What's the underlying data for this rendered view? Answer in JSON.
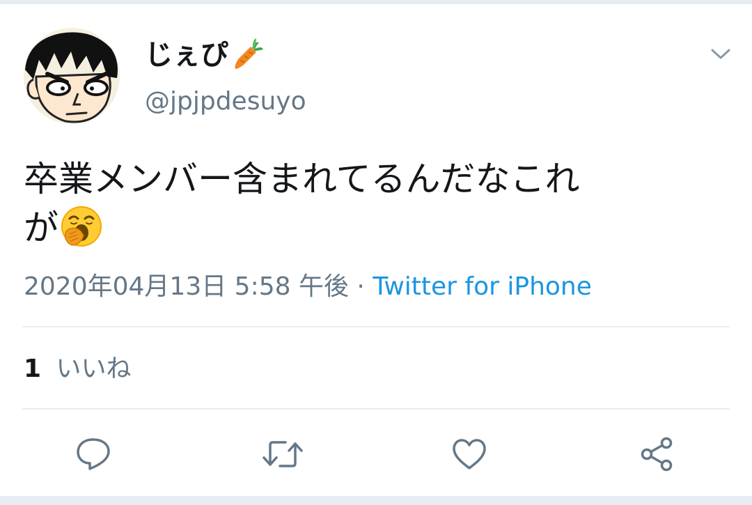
{
  "user": {
    "display_name": "じぇぴ",
    "name_emoji": "carrot-icon",
    "handle": "@jpjpdesuyo"
  },
  "tweet": {
    "text_line1": "卒業メンバー含まれてるんだなこれ",
    "text_line2": "が",
    "trailing_emoji": "yawning-face-icon",
    "timestamp": "2020年04月13日 5:58 午後",
    "separator": "·",
    "source": "Twitter for iPhone"
  },
  "stats": {
    "likes_count": "1",
    "likes_label": "いいね"
  },
  "actions": [
    "reply-icon",
    "retweet-icon",
    "like-icon",
    "share-icon"
  ],
  "colors": {
    "text": "#14171a",
    "secondary": "#657786",
    "link": "#1b95e0",
    "divider": "#e6ecf0"
  }
}
